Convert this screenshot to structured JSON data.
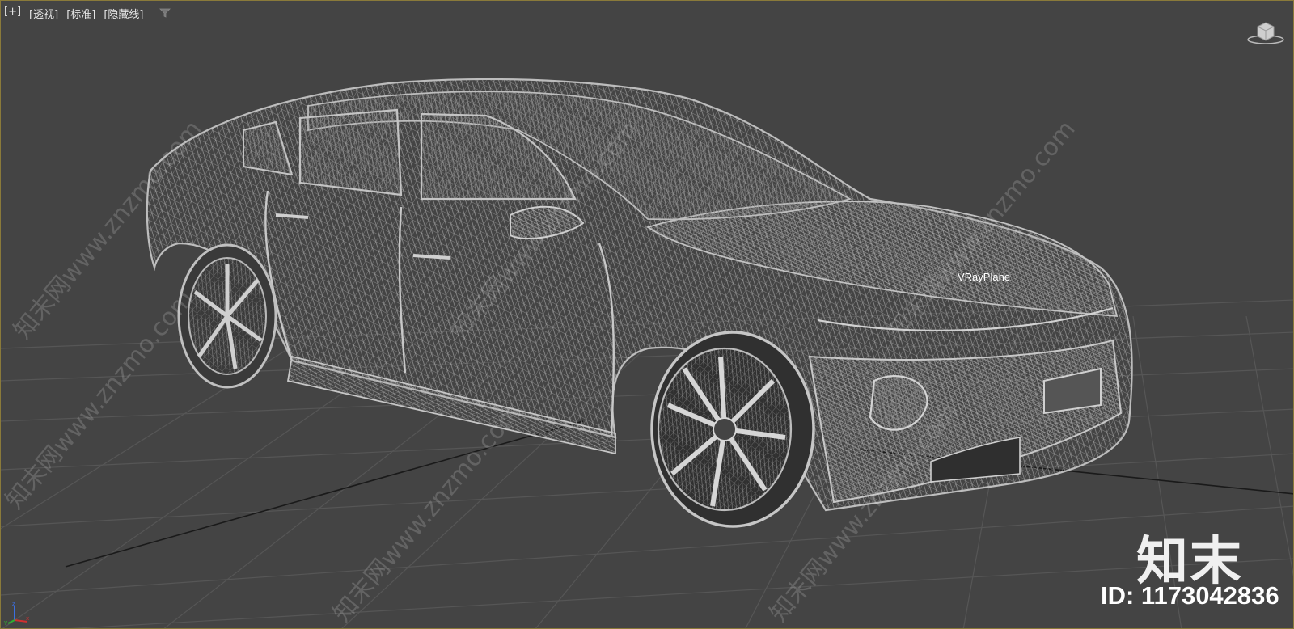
{
  "viewport": {
    "menu": {
      "plus": "[+]",
      "view": "[透视]",
      "shading": "[标准]",
      "style": "[隐藏线]"
    },
    "filter_icon": "filter-icon",
    "object_label": "VRayPlane"
  },
  "watermark": {
    "logo_text": "知末",
    "id_text": "ID: 1173042836",
    "tiled_text": "知末网www.znzmo.com"
  },
  "colors": {
    "viewport_bg": "#444444",
    "grid_line": "#5a5a5a",
    "wireframe": "#b4b4b4",
    "active_border": "#8a7a3a"
  }
}
